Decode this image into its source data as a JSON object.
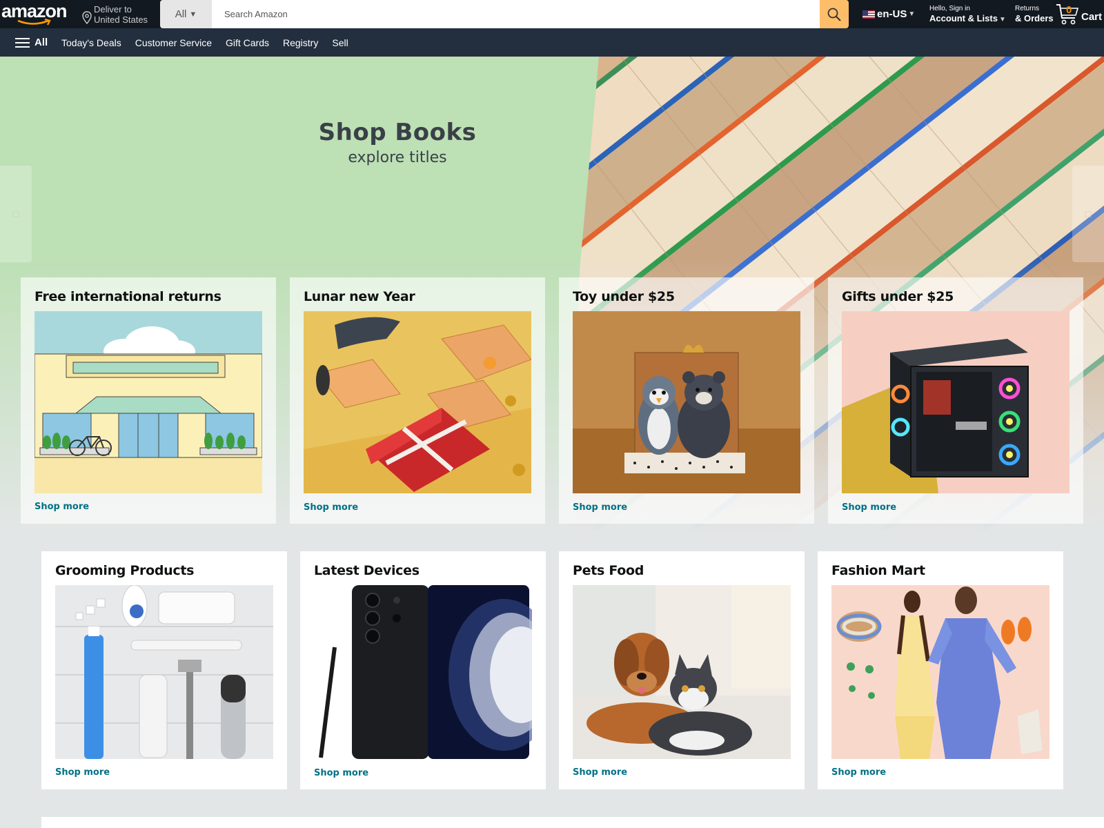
{
  "header": {
    "logo_text": "amazon",
    "deliver_line1": "Deliver to",
    "deliver_line2": "United States",
    "search_category": "All",
    "search_placeholder": "Search Amazon",
    "language": "en-US",
    "account_small": "Hello, Sign in",
    "account_big": "Account & Lists",
    "orders_small": "Returns",
    "orders_big": "& Orders",
    "cart_count": "0",
    "cart_label": "Cart"
  },
  "nav": {
    "all_label": "All",
    "links": [
      "Today's Deals",
      "Customer Service",
      "Gift Cards",
      "Registry",
      "Sell"
    ]
  },
  "hero": {
    "title": "Shop Books",
    "subtitle": "explore titles",
    "prev_icon": "chevron-left-icon",
    "next_icon": "chevron-right-icon"
  },
  "cards_row1": [
    {
      "title": "Free international returns",
      "link": "Shop more"
    },
    {
      "title": "Lunar new Year",
      "link": "Shop more"
    },
    {
      "title": "Toy under $25",
      "link": "Shop more"
    },
    {
      "title": "Gifts under $25",
      "link": "Shop more"
    }
  ],
  "cards_row2": [
    {
      "title": "Grooming Products",
      "link": "Shop more"
    },
    {
      "title": "Latest Devices",
      "link": "Shop more"
    },
    {
      "title": "Pets Food",
      "link": "Shop more"
    },
    {
      "title": "Fashion Mart",
      "link": "Shop more"
    }
  ],
  "colors": {
    "header_bg": "#131921",
    "nav_bg": "#232f3e",
    "search_button": "#febd69",
    "link": "#007185",
    "page_bg": "#e3e6e6",
    "hero_green": "#bde0b5"
  }
}
